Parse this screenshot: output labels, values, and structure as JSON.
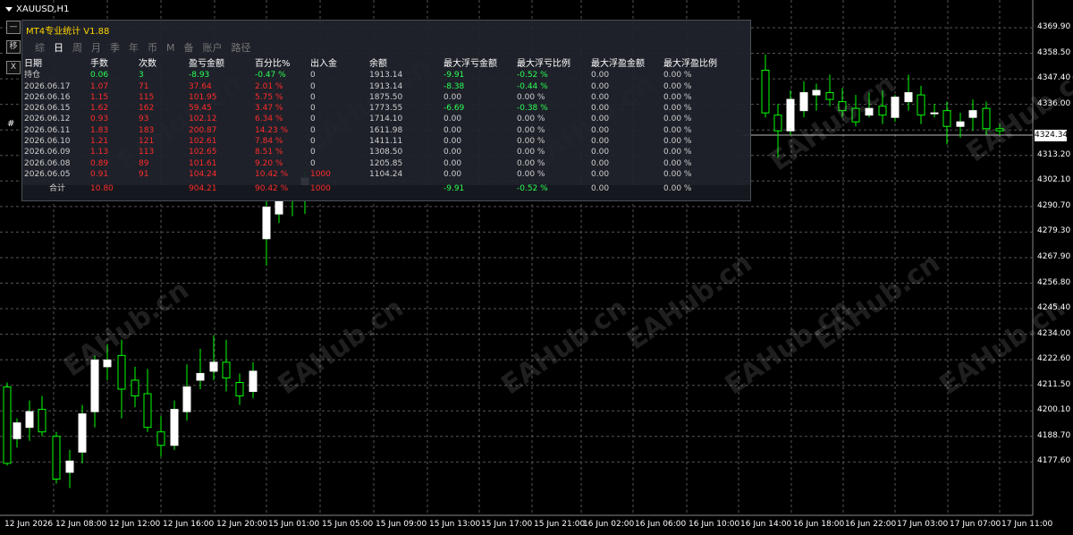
{
  "symbol": "XAUUSD,H1",
  "current_price": "4324.34",
  "y_axis": [
    "4369.90",
    "4358.50",
    "4347.40",
    "4336.00",
    "4324.34",
    "4313.20",
    "4302.10",
    "4290.70",
    "4279.30",
    "4267.90",
    "4256.80",
    "4245.40",
    "4234.00",
    "4222.60",
    "4211.50",
    "4200.10",
    "4188.70",
    "4177.60"
  ],
  "x_axis": [
    "12 Jun 2026",
    "12 Jun 08:00",
    "12 Jun 12:00",
    "12 Jun 16:00",
    "12 Jun 20:00",
    "15 Jun 01:00",
    "15 Jun 05:00",
    "15 Jun 09:00",
    "15 Jun 13:00",
    "15 Jun 17:00",
    "15 Jun 21:00",
    "16 Jun 02:00",
    "16 Jun 06:00",
    "16 Jun 10:00",
    "16 Jun 14:00",
    "16 Jun 18:00",
    "16 Jun 22:00",
    "17 Jun 03:00",
    "17 Jun 07:00",
    "17 Jun 11:00"
  ],
  "side_buttons": [
    "—",
    "移",
    "X"
  ],
  "side_label": "#",
  "watermark_text": "EAHub.cn",
  "panel": {
    "title": "MT4专业统计 V1.88",
    "tabs": [
      "综",
      "日",
      "周",
      "月",
      "季",
      "年",
      "币",
      "M",
      "备",
      "账户",
      "路径"
    ],
    "active_tab": "日",
    "headers": [
      "日期",
      "手数",
      "次数",
      "盈亏金额",
      "百分比%",
      "出入金",
      "余额",
      "最大浮亏金额",
      "最大浮亏比例",
      "最大浮盈金额",
      "最大浮盈比例"
    ],
    "position_row": [
      "持仓",
      "0.06",
      "3",
      "-8.93",
      "-0.47 %",
      "0",
      "1913.14",
      "-9.91",
      "-0.52 %",
      "0.00",
      "0.00 %"
    ],
    "rows": [
      [
        "2026.06.17",
        "1.07",
        "71",
        "37.64",
        "2.01 %",
        "0",
        "1913.14",
        "-8.38",
        "-0.44 %",
        "0.00",
        "0.00 %"
      ],
      [
        "2026.06.16",
        "1.15",
        "115",
        "101.95",
        "5.75 %",
        "0",
        "1875.50",
        "0.00",
        "0.00 %",
        "0.00",
        "0.00 %"
      ],
      [
        "2026.06.15",
        "1.62",
        "162",
        "59.45",
        "3.47 %",
        "0",
        "1773.55",
        "-6.69",
        "-0.38 %",
        "0.00",
        "0.00 %"
      ],
      [
        "2026.06.12",
        "0.93",
        "93",
        "102.12",
        "6.34 %",
        "0",
        "1714.10",
        "0.00",
        "0.00 %",
        "0.00",
        "0.00 %"
      ],
      [
        "2026.06.11",
        "1.83",
        "183",
        "200.87",
        "14.23 %",
        "0",
        "1611.98",
        "0.00",
        "0.00 %",
        "0.00",
        "0.00 %"
      ],
      [
        "2026.06.10",
        "1.21",
        "121",
        "102.61",
        "7.84 %",
        "0",
        "1411.11",
        "0.00",
        "0.00 %",
        "0.00",
        "0.00 %"
      ],
      [
        "2026.06.09",
        "1.13",
        "113",
        "102.65",
        "8.51 %",
        "0",
        "1308.50",
        "0.00",
        "0.00 %",
        "0.00",
        "0.00 %"
      ],
      [
        "2026.06.08",
        "0.89",
        "89",
        "101.61",
        "9.20 %",
        "0",
        "1205.85",
        "0.00",
        "0.00 %",
        "0.00",
        "0.00 %"
      ],
      [
        "2026.06.05",
        "0.91",
        "91",
        "104.24",
        "10.42 %",
        "1000",
        "1104.24",
        "0.00",
        "0.00 %",
        "0.00",
        "0.00 %"
      ]
    ],
    "total_row": [
      "合计",
      "10.80",
      "",
      "904.21",
      "90.42 %",
      "1000",
      "",
      "-9.91",
      "-0.52 %",
      "0.00",
      "0.00 %"
    ]
  },
  "colors": {
    "bull": "#ffffff",
    "bear": "#000000",
    "wick": "#00ff00",
    "grid": "#555555",
    "loss": "#ff2b2b",
    "profit": "#2bff55"
  }
}
